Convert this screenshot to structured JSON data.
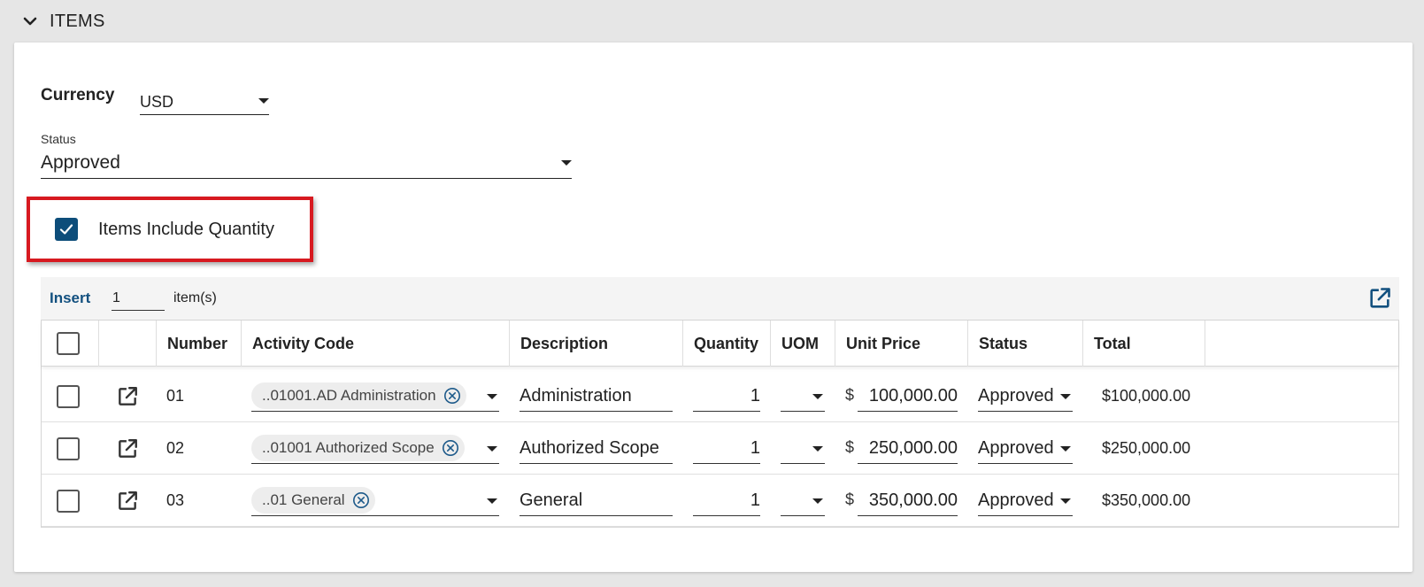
{
  "section": {
    "title": "ITEMS",
    "icon": "chevron-down-icon"
  },
  "currency": {
    "label": "Currency",
    "value": "USD"
  },
  "status_field": {
    "label": "Status",
    "value": "Approved"
  },
  "items_include_quantity": {
    "label": "Items Include Quantity",
    "checked": true
  },
  "toolbar": {
    "insert_label": "Insert",
    "insert_count": "1",
    "items_suffix": "item(s)"
  },
  "table": {
    "columns": [
      "Number",
      "Activity Code",
      "Description",
      "Quantity",
      "UOM",
      "Unit Price",
      "Status",
      "Total"
    ],
    "rows": [
      {
        "number": "01",
        "activity_code": "..01001.AD Administration",
        "description": "Administration",
        "quantity": "1",
        "uom": "",
        "currency_symbol": "$",
        "unit_price": "100,000.00",
        "status": "Approved",
        "total": "$100,000.00"
      },
      {
        "number": "02",
        "activity_code": "..01001 Authorized Scope",
        "description": "Authorized Scope",
        "quantity": "1",
        "uom": "",
        "currency_symbol": "$",
        "unit_price": "250,000.00",
        "status": "Approved",
        "total": "$250,000.00"
      },
      {
        "number": "03",
        "activity_code": "..01 General",
        "description": "General",
        "quantity": "1",
        "uom": "",
        "currency_symbol": "$",
        "unit_price": "350,000.00",
        "status": "Approved",
        "total": "$350,000.00"
      }
    ]
  },
  "colors": {
    "accent": "#0d4d7a",
    "link": "#12507f",
    "highlight": "#d71920"
  }
}
